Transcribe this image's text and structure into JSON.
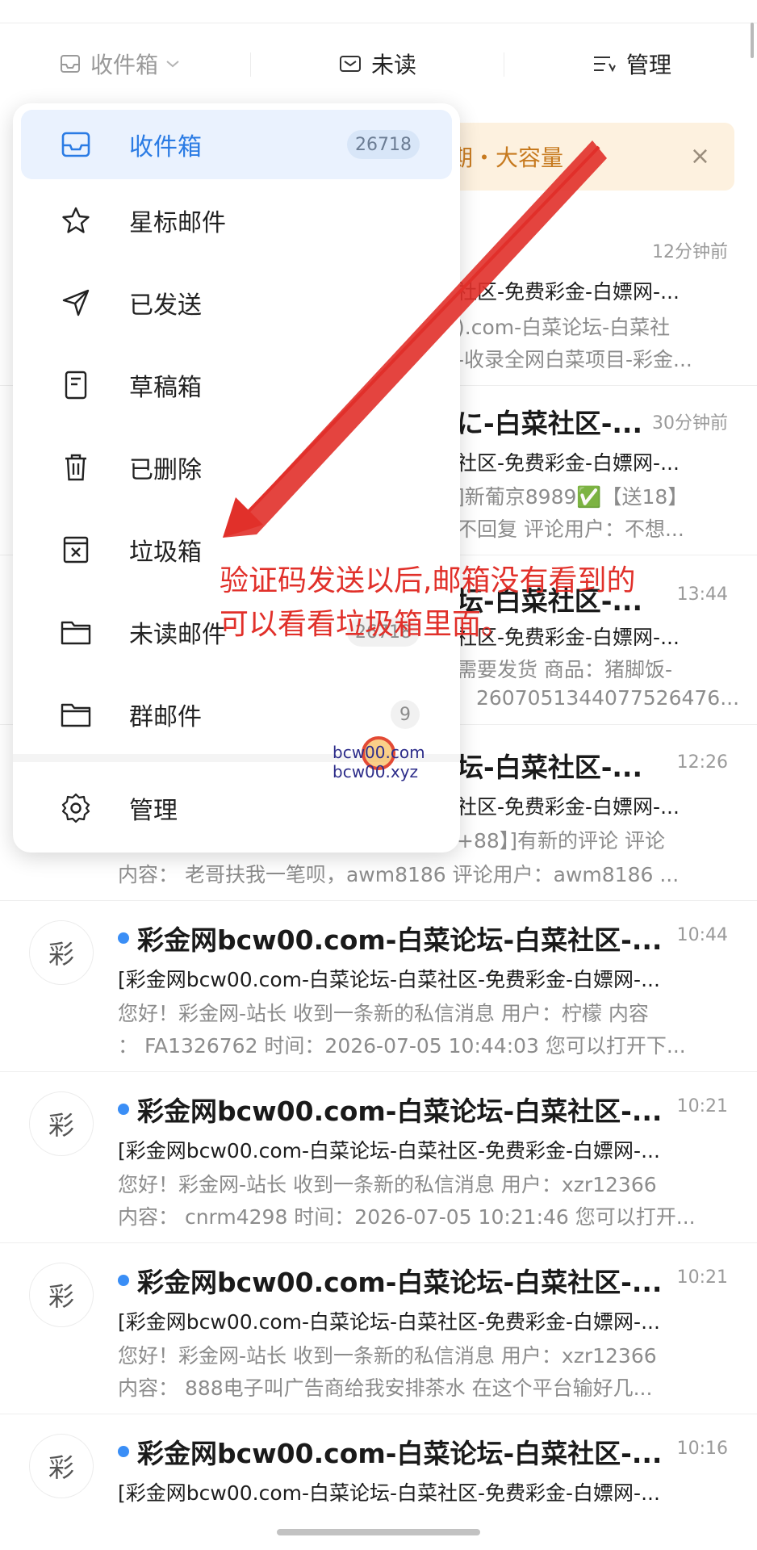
{
  "toolbar": {
    "folder_label": "收件箱",
    "unread_label": "未读",
    "manage_label": "管理"
  },
  "promo": {
    "text": "期・大容量",
    "close": "×"
  },
  "mails": [
    {
      "avatar": "",
      "sender": "",
      "time": "12分钟前",
      "subject": "社区-免费彩金-白嫖网-...",
      "preview1": ").com-白菜论坛-白菜社",
      "preview2": "-收录全网白菜项目-彩金..."
    },
    {
      "avatar": "",
      "sender": "に-白菜社区-...",
      "time": "30分钟前",
      "subject": "社区-免费彩金-白嫖网-...",
      "preview1": "]新葡京8989✅【送18】",
      "preview2": "不回复 评论用户：不想..."
    },
    {
      "avatar": "",
      "sender": "坛-白菜社区-...",
      "time": "13:44",
      "subject": "社区-免费彩金-白嫖网-...",
      "preview1": "需要发货 商品：猪脚饭-",
      "preview2": "2607051344077526476..."
    },
    {
      "avatar": "",
      "sender": "坛-白菜社区-...",
      "time": "12:26",
      "subject": "社区-免费彩金-白嫖网-...",
      "preview1": "+88】]有新的评论 评论",
      "preview2": "内容： 老哥扶我一笔呗，awm8186 评论用户：awm8186 ..."
    },
    {
      "avatar": "彩",
      "sender": "彩金网bcw00.com-白菜论坛-白菜社区-...",
      "time": "10:44",
      "subject": "[彩金网bcw00.com-白菜论坛-白菜社区-免费彩金-白嫖网-...",
      "preview1": "您好！彩金网-站长 收到一条新的私信消息 用户：柠檬 内容",
      "preview2": "： FA1326762 时间：2026-07-05 10:44:03 您可以打开下..."
    },
    {
      "avatar": "彩",
      "sender": "彩金网bcw00.com-白菜论坛-白菜社区-...",
      "time": "10:21",
      "subject": "[彩金网bcw00.com-白菜论坛-白菜社区-免费彩金-白嫖网-...",
      "preview1": "您好！彩金网-站长 收到一条新的私信消息 用户：xzr12366",
      "preview2": "内容： cnrm4298 时间：2026-07-05 10:21:46 您可以打开..."
    },
    {
      "avatar": "彩",
      "sender": "彩金网bcw00.com-白菜论坛-白菜社区-...",
      "time": "10:21",
      "subject": "[彩金网bcw00.com-白菜论坛-白菜社区-免费彩金-白嫖网-...",
      "preview1": "您好！彩金网-站长 收到一条新的私信消息 用户：xzr12366",
      "preview2": "内容： 888电子叫广告商给我安排茶水 在这个平台输好几..."
    },
    {
      "avatar": "彩",
      "sender": "彩金网bcw00.com-白菜论坛-白菜社区-...",
      "time": "10:16",
      "subject": "[彩金网bcw00.com-白菜论坛-白菜社区-免费彩金-白嫖网-...",
      "preview1": "",
      "preview2": ""
    }
  ],
  "dropdown": {
    "items": [
      {
        "label": "收件箱",
        "count": "26718",
        "icon": "inbox-icon"
      },
      {
        "label": "星标邮件",
        "count": "",
        "icon": "star-icon"
      },
      {
        "label": "已发送",
        "count": "",
        "icon": "send-icon"
      },
      {
        "label": "草稿箱",
        "count": "",
        "icon": "draft-icon"
      },
      {
        "label": "已删除",
        "count": "",
        "icon": "trash-icon"
      },
      {
        "label": "垃圾箱",
        "count": "",
        "icon": "spam-icon"
      },
      {
        "label": "未读邮件",
        "count": "26718",
        "icon": "folder-icon"
      },
      {
        "label": "群邮件",
        "count": "9",
        "icon": "folder-icon"
      },
      {
        "label": "管理",
        "count": "",
        "icon": "gear-icon"
      }
    ]
  },
  "annotation": {
    "line1": "验证码发送以后,邮箱没有看到的",
    "line2": "可以看看垃圾箱里面。"
  },
  "watermark": {
    "line1": "bcw00.com",
    "line2": "bcw00.xyz"
  },
  "colors": {
    "accent": "#2a7be4",
    "unread_dot": "#3a8ef6",
    "annotation": "#e1302a",
    "promo_bg": "#fdf1df"
  }
}
